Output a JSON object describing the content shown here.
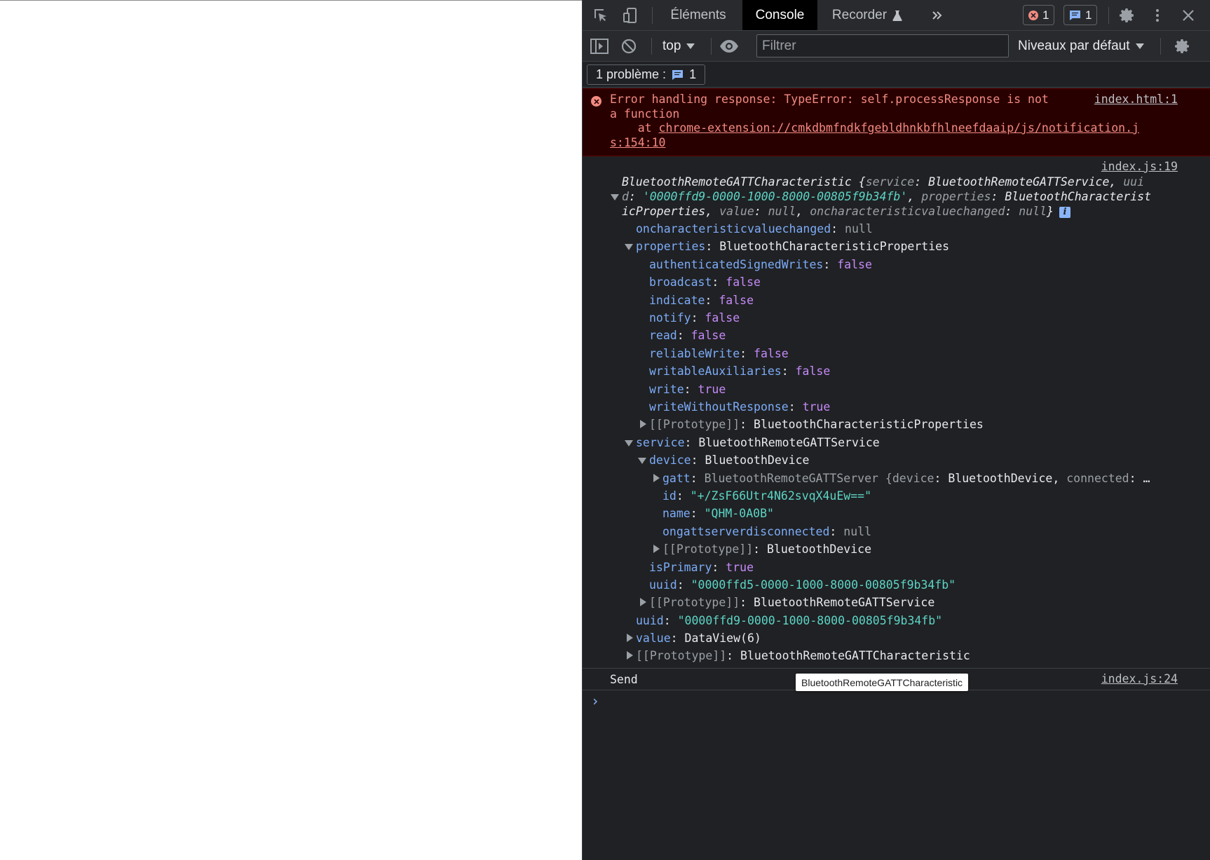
{
  "tabs": [
    {
      "label": "Éléments"
    },
    {
      "label": "Console"
    },
    {
      "label": "Recorder"
    }
  ],
  "badges": {
    "errors": "1",
    "messages": "1"
  },
  "toolbar": {
    "context": "top",
    "filter_placeholder": "Filtrer",
    "levels": "Niveaux par défaut"
  },
  "issues": {
    "label": "1 problème :",
    "count": "1"
  },
  "error": {
    "line1": "Error handling response: TypeError: self.processResponse is not",
    "line2": "a function",
    "line3_prefix": "    at ",
    "line3_link": "chrome-extension://cmkdbmfndkfgebldhnkbfhlneefdaaip/js/notification.j",
    "line4_link": "s:154:10",
    "source": "index.html:1"
  },
  "log1": {
    "source": "index.js:19",
    "head1_a": "BluetoothRemoteGATTCharacteristic {",
    "head1_b": "service",
    "head1_c": ": BluetoothRemoteGATTService, ",
    "head1_d": "uui",
    "head2_a": "d",
    "head2_b": ": ",
    "head2_c": "'0000ffd9-0000-1000-8000-00805f9b34fb'",
    "head2_d": ", ",
    "head2_e": "properties",
    "head2_f": ": BluetoothCharacterist",
    "head3_a": "icProperties, ",
    "head3_b": "value",
    "head3_c": ": ",
    "head3_d": "null",
    "head3_e": ", ",
    "head3_f": "oncharacteristicvaluechanged",
    "head3_g": ": ",
    "head3_h": "null",
    "head3_i": "}",
    "info": "i",
    "oncharacteristicvaluechanged": {
      "key": "oncharacteristicvaluechanged",
      "val": "null"
    },
    "properties": {
      "key": "properties",
      "val": "BluetoothCharacteristicProperties"
    },
    "props": [
      {
        "key": "authenticatedSignedWrites",
        "val": "false"
      },
      {
        "key": "broadcast",
        "val": "false"
      },
      {
        "key": "indicate",
        "val": "false"
      },
      {
        "key": "notify",
        "val": "false"
      },
      {
        "key": "read",
        "val": "false"
      },
      {
        "key": "reliableWrite",
        "val": "false"
      },
      {
        "key": "writableAuxiliaries",
        "val": "false"
      },
      {
        "key": "write",
        "val": "true"
      },
      {
        "key": "writeWithoutResponse",
        "val": "true"
      }
    ],
    "props_proto": {
      "key": "[[Prototype]]",
      "val": "BluetoothCharacteristicProperties"
    },
    "service": {
      "key": "service",
      "val": "BluetoothRemoteGATTService"
    },
    "device": {
      "key": "device",
      "val": "BluetoothDevice"
    },
    "gatt": {
      "key": "gatt",
      "a": "BluetoothRemoteGATTServer {",
      "b": "device",
      "c": ": BluetoothDevice, ",
      "d": "connected",
      "e": ": …"
    },
    "id": {
      "key": "id",
      "val": "\"+/ZsF66Utr4N62svqX4uEw==\""
    },
    "name": {
      "key": "name",
      "val": "\"QHM-0A0B\""
    },
    "ongattserverdisconnected": {
      "key": "ongattserverdisconnected",
      "val": "null"
    },
    "device_proto": {
      "key": "[[Prototype]]",
      "val": "BluetoothDevice"
    },
    "isPrimary": {
      "key": "isPrimary",
      "val": "true"
    },
    "service_uuid": {
      "key": "uuid",
      "val": "\"0000ffd5-0000-1000-8000-00805f9b34fb\""
    },
    "service_proto": {
      "key": "[[Prototype]]",
      "val": "BluetoothRemoteGATTService"
    },
    "uuid": {
      "key": "uuid",
      "val": "\"0000ffd9-0000-1000-8000-00805f9b34fb\""
    },
    "value": {
      "key": "value",
      "val": "DataView(6)"
    },
    "proto": {
      "key": "[[Prototype]]",
      "val": "BluetoothRemoteGATTCharacteristic"
    }
  },
  "log2": {
    "text": "Send",
    "source": "index.js:24"
  },
  "tooltip": "BluetoothRemoteGATTCharacteristic",
  "prompt": "›"
}
